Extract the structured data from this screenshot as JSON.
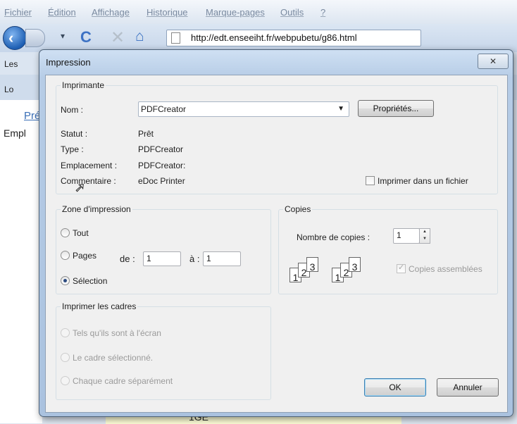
{
  "browser": {
    "menu": [
      "Fichier",
      "Édition",
      "Affichage",
      "Historique",
      "Marque-pages",
      "Outils",
      "?"
    ],
    "url": "http://edt.enseeiht.fr/webpubetu/g86.html",
    "bookmark_label": "Les",
    "tab_label": "Lo",
    "page_link": "Pré",
    "page_text": "Empl",
    "page_footer": "1GE"
  },
  "dialog": {
    "title": "Impression",
    "close_glyph": "✕",
    "printer": {
      "legend": "Imprimante",
      "name_label": "Nom :",
      "name_value": "PDFCreator",
      "properties_button": "Propriétés...",
      "status_label": "Statut :",
      "status_value": "Prêt",
      "type_label": "Type :",
      "type_value": "PDFCreator",
      "location_label": "Emplacement :",
      "location_value": "PDFCreator:",
      "comment_label": "Commentaire :",
      "comment_value": "eDoc Printer",
      "print_to_file_label": "Imprimer dans un fichier",
      "print_to_file_checked": false
    },
    "range": {
      "legend": "Zone d'impression",
      "all_label": "Tout",
      "pages_label": "Pages",
      "from_label": "de :",
      "from_value": "1",
      "to_label": "à :",
      "to_value": "1",
      "selection_label": "Sélection",
      "selected": "selection"
    },
    "copies": {
      "legend": "Copies",
      "count_label": "Nombre de copies :",
      "count_value": "1",
      "collate_label": "Copies assemblées",
      "collate_checked": true,
      "collate_enabled": false,
      "sheet_numbers": [
        "1",
        "2",
        "3"
      ]
    },
    "frames": {
      "legend": "Imprimer les cadres",
      "options": [
        "Tels qu'ils sont à l'écran",
        "Le cadre sélectionné.",
        "Chaque cadre séparément"
      ]
    },
    "ok_button": "OK",
    "cancel_button": "Annuler"
  }
}
